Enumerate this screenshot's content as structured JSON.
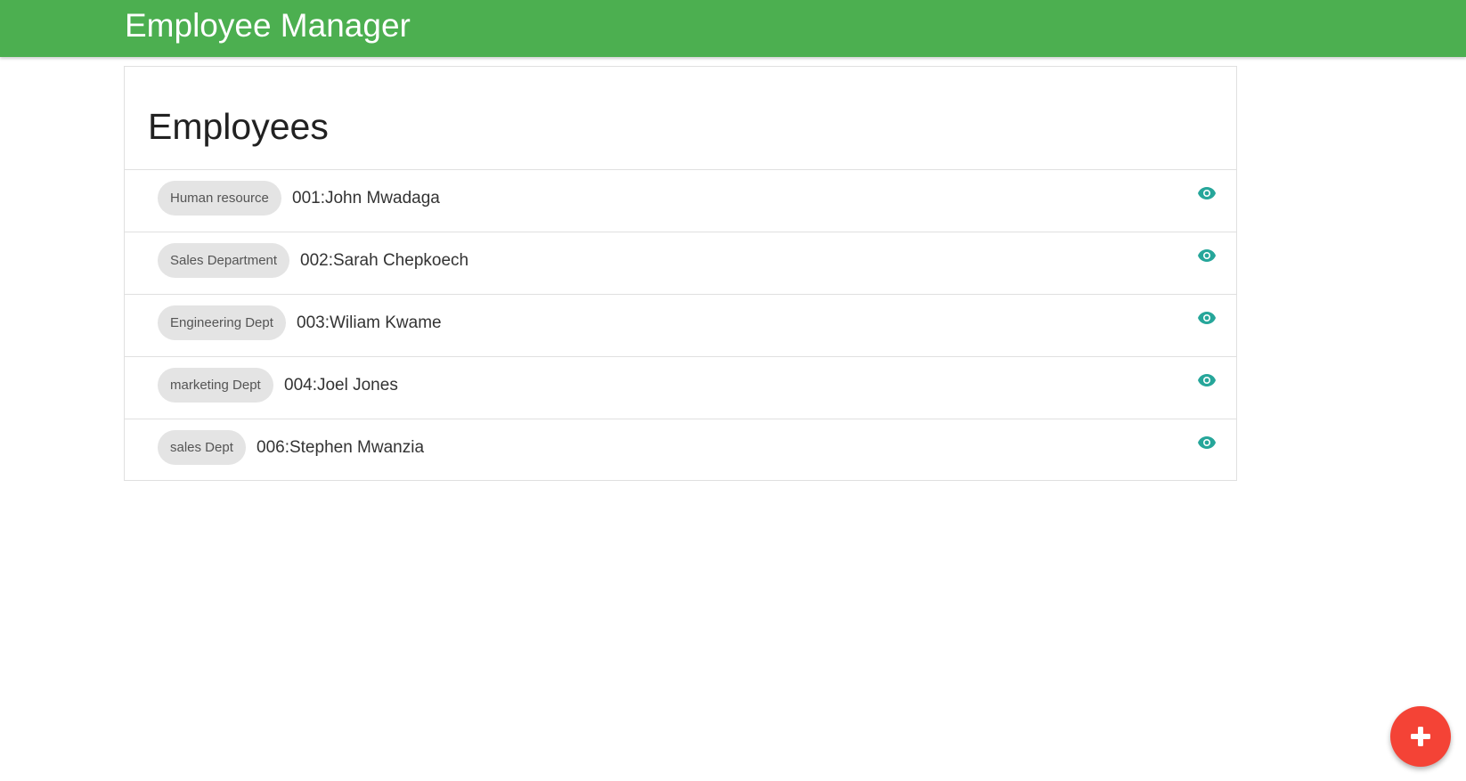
{
  "app": {
    "title": "Employee Manager"
  },
  "main": {
    "heading": "Employees"
  },
  "employees": [
    {
      "department": "Human resource",
      "label": "001:John Mwadaga"
    },
    {
      "department": "Sales Department",
      "label": "002:Sarah Chepkoech"
    },
    {
      "department": "Engineering Dept",
      "label": "003:Wiliam Kwame"
    },
    {
      "department": "marketing Dept",
      "label": "004:Joel Jones"
    },
    {
      "department": "sales Dept",
      "label": "006:Stephen Mwanzia"
    }
  ],
  "icons": {
    "row_action": "eye-icon",
    "fab": "plus-icon"
  },
  "colors": {
    "navbar": "#4caf50",
    "accent_icon": "#26a69a",
    "fab": "#f44336",
    "chip": "#e4e4e4"
  }
}
